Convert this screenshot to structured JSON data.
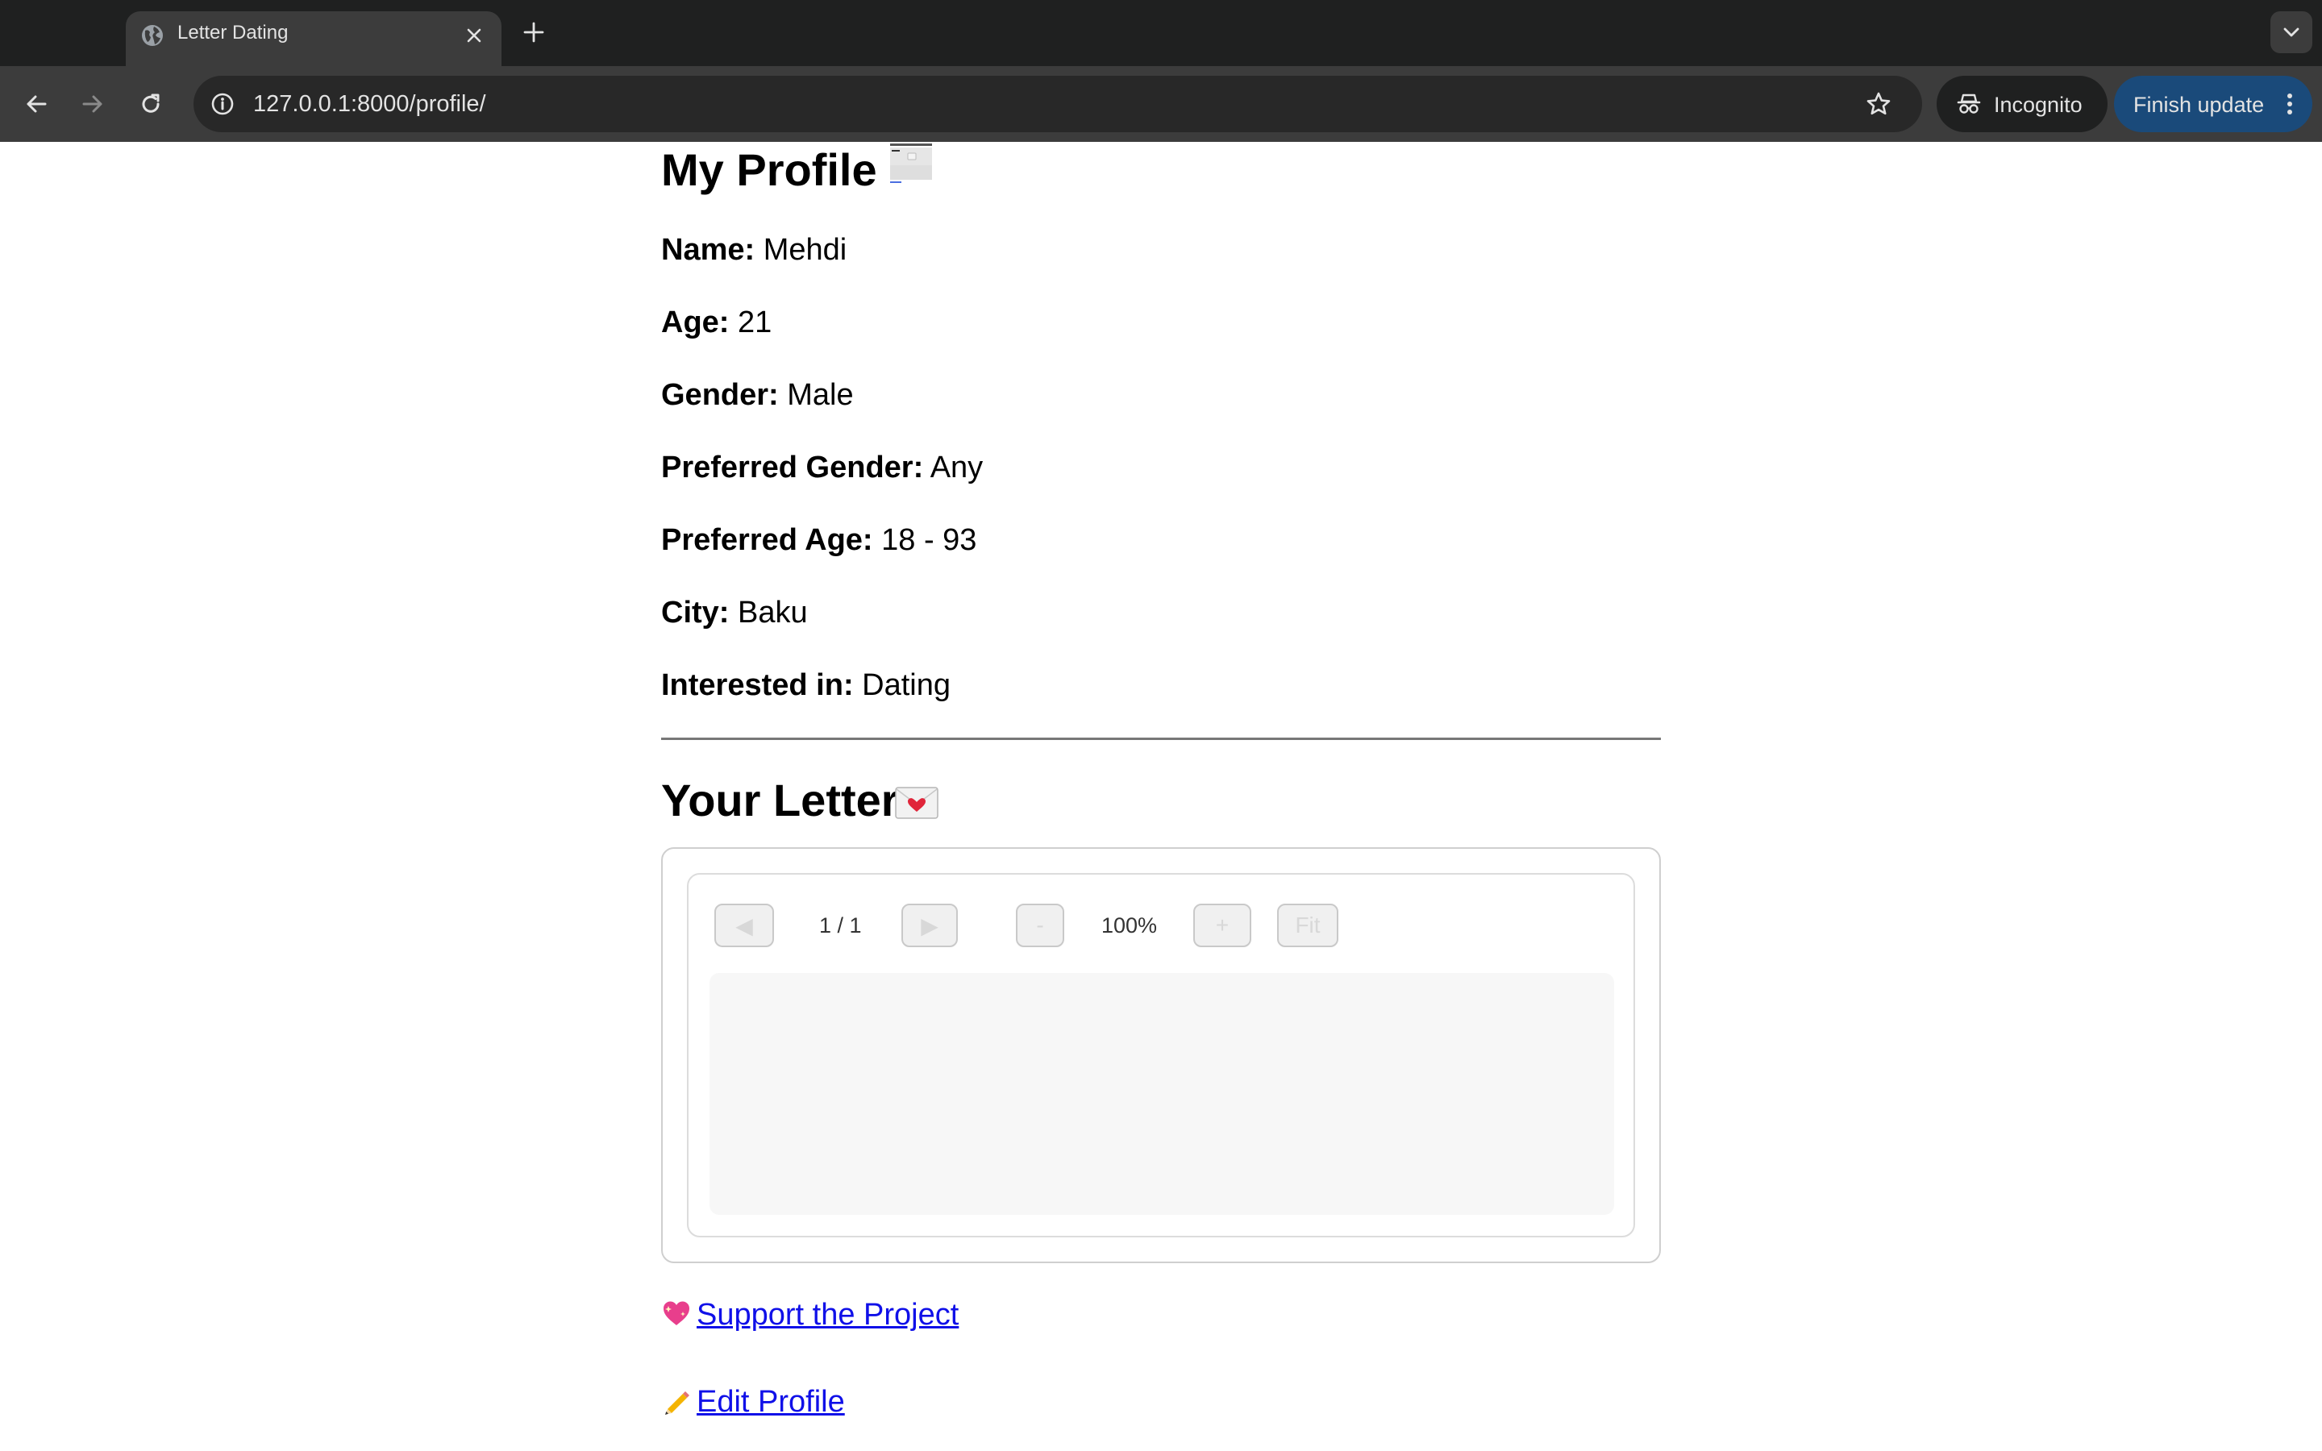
{
  "browser": {
    "tab_title": "Letter Dating",
    "url": "127.0.0.1:8000/profile/",
    "incognito_label": "Incognito",
    "finish_update_label": "Finish update"
  },
  "profile": {
    "title": "My Profile",
    "fields": [
      {
        "label": "Name:",
        "value": "Mehdi"
      },
      {
        "label": "Age:",
        "value": "21"
      },
      {
        "label": "Gender:",
        "value": "Male"
      },
      {
        "label": "Preferred Gender:",
        "value": "Any"
      },
      {
        "label": "Preferred Age:",
        "value": "18 - 93"
      },
      {
        "label": "City:",
        "value": "Baku"
      },
      {
        "label": "Interested in:",
        "value": "Dating"
      }
    ]
  },
  "letter": {
    "title": "Your Letter",
    "viewer": {
      "prev_label": "◀",
      "next_label": "▶",
      "page_indicator": "1 / 1",
      "zoom_out_label": "-",
      "zoom_level": "100%",
      "zoom_in_label": "+",
      "fit_label": "Fit"
    }
  },
  "links": {
    "support": "Support the Project",
    "edit_profile": "Edit Profile"
  },
  "colors": {
    "link": "#1010e8",
    "chrome_dark": "#1f2020",
    "toolbar": "#3c3c3c",
    "update_button": "#1a4a7a"
  },
  "icons": {
    "tab_favicon": "globe-icon",
    "profile_title": "image-thumbnail-icon",
    "letter_title": "love-letter-icon",
    "support": "sparkling-heart-icon",
    "edit_profile": "pencil-icon"
  }
}
